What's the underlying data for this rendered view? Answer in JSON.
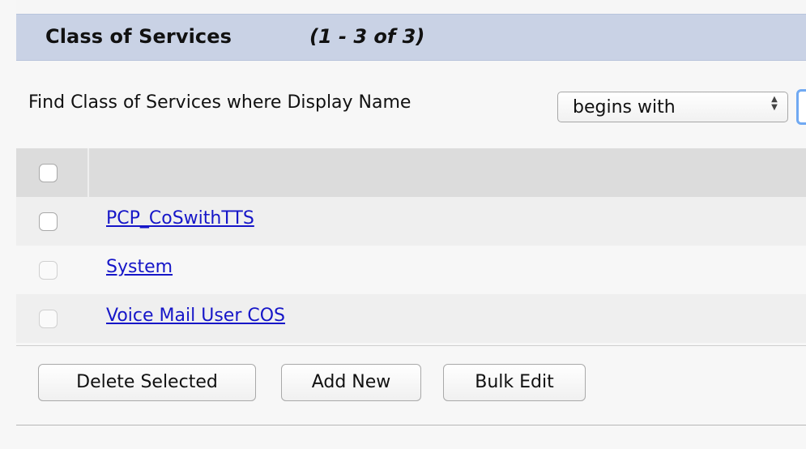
{
  "header": {
    "title": "Class of Services",
    "count": "(1 - 3 of 3)"
  },
  "search": {
    "prefix": "Find Class of Services  where Display Name",
    "condition": "begins with",
    "input_value": "",
    "input_placeholder": ""
  },
  "table": {
    "header_checkbox": "",
    "rows": [
      {
        "label": "PCP_CoSwithTTS",
        "checkbox_state": "enabled"
      },
      {
        "label": "System",
        "checkbox_state": "disabled"
      },
      {
        "label": "Voice Mail User COS",
        "checkbox_state": "disabled"
      }
    ]
  },
  "actions": {
    "delete_label": "Delete Selected",
    "add_new_label": "Add New",
    "bulk_edit_label": "Bulk Edit"
  },
  "colors": {
    "header_bg": "#c9d2e5",
    "link": "#1616c8",
    "table_header_bg": "#dcdcdc",
    "focus_border": "#70a9f2"
  },
  "icons": {
    "select_arrows": "select-arrows-icon"
  }
}
